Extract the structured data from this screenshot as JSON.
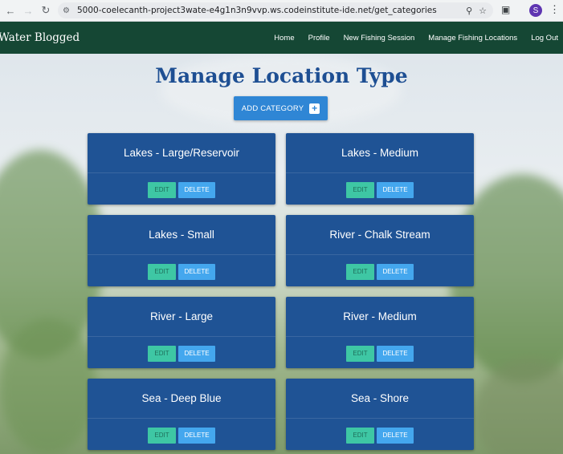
{
  "browser": {
    "url": "5000-coelecanth-project3wate-e4g1n3n9vvp.ws.codeinstitute-ide.net/get_categories",
    "profile_initial": "S"
  },
  "nav": {
    "brand": "Water Blogged",
    "links": [
      "Home",
      "Profile",
      "New Fishing Session",
      "Manage Fishing Locations",
      "Log Out"
    ]
  },
  "page": {
    "title": "Manage Location Type",
    "add_button": "ADD CATEGORY"
  },
  "categories": [
    {
      "name": "Lakes - Large/Reservoir",
      "edit": "EDIT",
      "delete": "DELETE"
    },
    {
      "name": "Lakes - Medium",
      "edit": "EDIT",
      "delete": "DELETE"
    },
    {
      "name": "Lakes - Small",
      "edit": "EDIT",
      "delete": "DELETE"
    },
    {
      "name": "River - Chalk Stream",
      "edit": "EDIT",
      "delete": "DELETE"
    },
    {
      "name": "River - Large",
      "edit": "EDIT",
      "delete": "DELETE"
    },
    {
      "name": "River - Medium",
      "edit": "EDIT",
      "delete": "DELETE"
    },
    {
      "name": "Sea - Deep Blue",
      "edit": "EDIT",
      "delete": "DELETE"
    },
    {
      "name": "Sea - Shore",
      "edit": "EDIT",
      "delete": "DELETE"
    }
  ],
  "colors": {
    "navbar": "#154734",
    "card": "#1f5395",
    "edit_button": "#3ec7a4",
    "delete_button": "#44a7ee",
    "add_button": "#2f86d5",
    "title": "#1e4f93"
  }
}
